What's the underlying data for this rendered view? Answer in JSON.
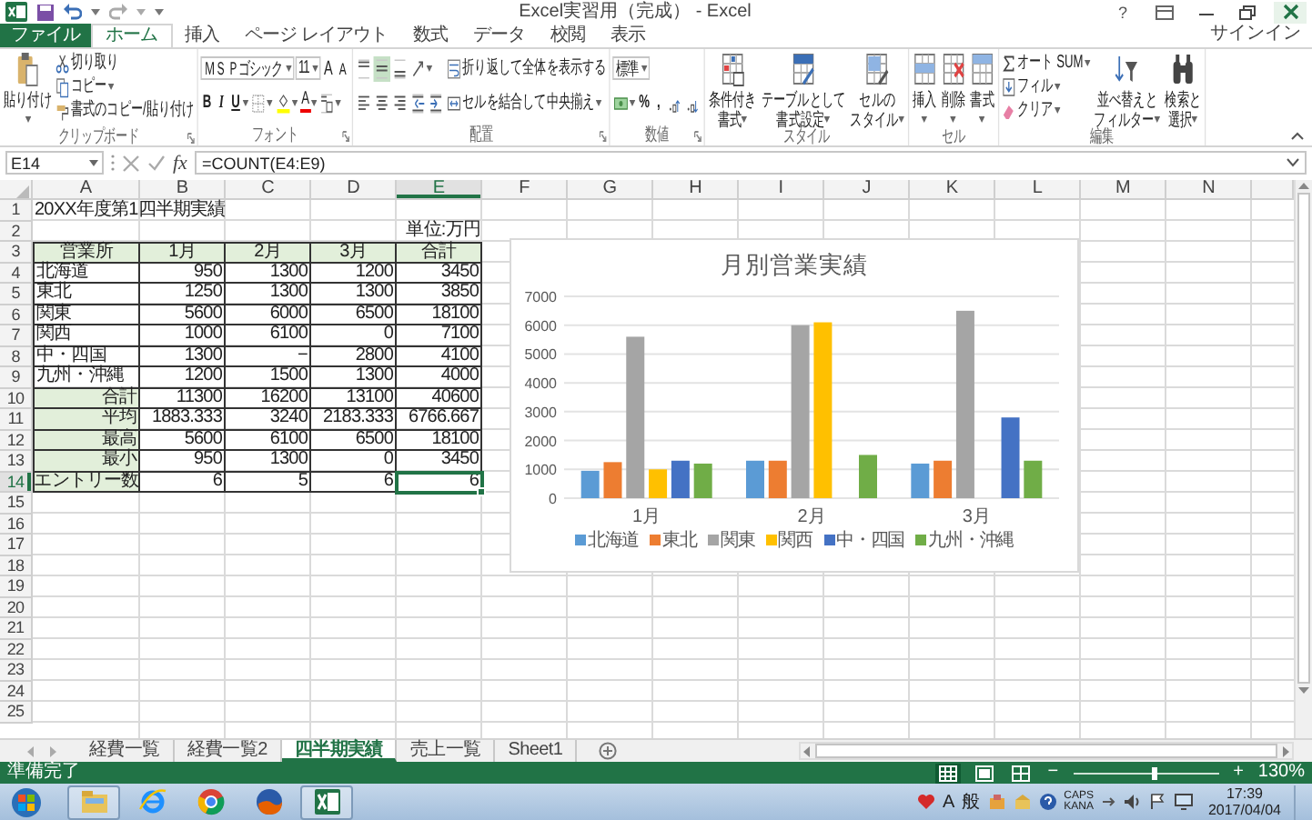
{
  "window": {
    "title": "Excel実習用（完成） - Excel",
    "help": "?",
    "sign_in": "サインイン"
  },
  "ribbon_tabs": [
    {
      "label": "ファイル",
      "kind": "file",
      "selected": false
    },
    {
      "label": "ホーム",
      "kind": "tab",
      "selected": true
    },
    {
      "label": "挿入",
      "kind": "tab",
      "selected": false
    },
    {
      "label": "ページ レイアウト",
      "kind": "tab",
      "selected": false
    },
    {
      "label": "数式",
      "kind": "tab",
      "selected": false
    },
    {
      "label": "データ",
      "kind": "tab",
      "selected": false
    },
    {
      "label": "校閲",
      "kind": "tab",
      "selected": false
    },
    {
      "label": "表示",
      "kind": "tab",
      "selected": false
    }
  ],
  "ribbon_groups": [
    {
      "label": "クリップボード",
      "launcher": true,
      "stacks": [
        [
          [
            {
              "kind": "paste",
              "large": true,
              "lines": [
                "貼り付け"
              ],
              "dropdown": true
            }
          ]
        ],
        [
          [
            {
              "kind": "cut",
              "large": false,
              "label": "切り取り"
            }
          ],
          [
            {
              "kind": "copy",
              "large": false,
              "label": "コピー",
              "dropdown": true
            }
          ],
          [
            {
              "kind": "brush",
              "large": false,
              "label": "書式のコピー/貼り付け"
            }
          ]
        ]
      ]
    },
    {
      "label": "フォント",
      "launcher": true,
      "stacks": [
        [
          [
            {
              "kind": "field",
              "value": "ＭＳ Ｐゴシック",
              "dropdown": true
            },
            {
              "kind": "field",
              "value": "11",
              "dropdown": true
            },
            {
              "kind": "grow",
              "label": "A"
            },
            {
              "kind": "shrink",
              "label": "A"
            }
          ],
          [
            {
              "kind": "glyph",
              "label": "B"
            },
            {
              "kind": "glyph",
              "label": "I"
            },
            {
              "kind": "glyph",
              "label": "U",
              "dropdown": true
            },
            {
              "kind": "border",
              "dropdown": true
            },
            {
              "kind": "bucket",
              "dropdown": true
            },
            {
              "kind": "fontcolor",
              "label": "A",
              "dropdown": true
            },
            {
              "kind": "ruby",
              "dropdown": true
            }
          ]
        ]
      ]
    },
    {
      "label": "配置",
      "launcher": true,
      "stacks": [
        [
          [
            {
              "kind": "aligntop",
              "selected": false
            },
            {
              "kind": "alignmiddle",
              "selected": true
            },
            {
              "kind": "alignbottom",
              "selected": false
            },
            {
              "kind": "orient",
              "dropdown": true
            }
          ],
          [
            {
              "kind": "alignleft",
              "selected": false
            },
            {
              "kind": "aligncenter",
              "selected": false
            },
            {
              "kind": "alignright",
              "selected": false
            },
            {
              "kind": "indentdec"
            },
            {
              "kind": "indentinc"
            }
          ]
        ],
        [
          [
            {
              "kind": "wrap",
              "large": false,
              "label": "折り返して全体を表示する"
            }
          ],
          [
            {
              "kind": "merge",
              "large": false,
              "label": "セルを結合して中央揃え",
              "dropdown": true
            }
          ]
        ]
      ]
    },
    {
      "label": "数値",
      "launcher": true,
      "stacks": [
        [
          [
            {
              "kind": "field",
              "value": "標準",
              "dropdown": true
            }
          ],
          [
            {
              "kind": "currency",
              "dropdown": true
            },
            {
              "kind": "numglyph",
              "label": "%"
            },
            {
              "kind": "numglyph",
              "label": ","
            },
            {
              "kind": "decinc"
            },
            {
              "kind": "decdec"
            }
          ]
        ]
      ]
    },
    {
      "label": "スタイル",
      "launcher": false,
      "stacks": [
        [
          [
            {
              "kind": "cond",
              "large": true,
              "lines": [
                "条件付き",
                "書式"
              ],
              "dropdown": true
            }
          ]
        ],
        [
          [
            {
              "kind": "tableformat",
              "large": true,
              "lines": [
                "テーブルとして",
                "書式設定"
              ],
              "dropdown": true
            }
          ]
        ],
        [
          [
            {
              "kind": "cellstyle",
              "large": true,
              "lines": [
                "セルの",
                "スタイル"
              ],
              "dropdown": true
            }
          ]
        ]
      ]
    },
    {
      "label": "セル",
      "launcher": false,
      "stacks": [
        [
          [
            {
              "kind": "insert",
              "large": true,
              "lines": [
                "挿入"
              ],
              "dropdown": true
            }
          ]
        ],
        [
          [
            {
              "kind": "delete",
              "large": true,
              "lines": [
                "削除"
              ],
              "dropdown": true
            }
          ]
        ],
        [
          [
            {
              "kind": "format",
              "large": true,
              "lines": [
                "書式"
              ],
              "dropdown": true
            }
          ]
        ]
      ]
    },
    {
      "label": "編集",
      "launcher": false,
      "stacks": [
        [
          [
            {
              "kind": "sigma",
              "large": false,
              "label": "オート SUM",
              "dropdown": true
            }
          ],
          [
            {
              "kind": "filldown",
              "large": false,
              "label": "フィル",
              "dropdown": true
            }
          ],
          [
            {
              "kind": "eraser",
              "large": false,
              "label": "クリア",
              "dropdown": true
            }
          ]
        ],
        [
          [
            {
              "kind": "sort",
              "large": true,
              "lines": [
                "並べ替えと",
                "フィルター"
              ],
              "dropdown": true
            }
          ]
        ],
        [
          [
            {
              "kind": "find",
              "large": true,
              "lines": [
                "検索と",
                "選択"
              ],
              "dropdown": true
            }
          ]
        ]
      ]
    }
  ],
  "formula_bar": {
    "name_box": "E14",
    "function_label": "fx",
    "formula": "=COUNT(E4:E9)"
  },
  "sheet": {
    "columns": [
      {
        "label": "A",
        "selected": false
      },
      {
        "label": "B",
        "selected": false
      },
      {
        "label": "C",
        "selected": false
      },
      {
        "label": "D",
        "selected": false
      },
      {
        "label": "E",
        "selected": true
      },
      {
        "label": "F",
        "selected": false
      },
      {
        "label": "G",
        "selected": false
      },
      {
        "label": "H",
        "selected": false
      },
      {
        "label": "I",
        "selected": false
      },
      {
        "label": "J",
        "selected": false
      },
      {
        "label": "K",
        "selected": false
      },
      {
        "label": "L",
        "selected": false
      },
      {
        "label": "M",
        "selected": false
      },
      {
        "label": "N",
        "selected": false
      }
    ],
    "rows": [
      {
        "number": "1",
        "selected": false,
        "kind": "title",
        "text": "20XX年度第1四半期実績"
      },
      {
        "number": "2",
        "selected": false,
        "kind": "unit",
        "text": "単位:万円"
      },
      {
        "number": "3",
        "selected": false,
        "kind": "header",
        "cells": [
          "営業所",
          "1月",
          "2月",
          "3月",
          "合計"
        ]
      },
      {
        "number": "4",
        "selected": false,
        "kind": "data",
        "cells": [
          "北海道",
          "950",
          "1300",
          "1200",
          "3450"
        ]
      },
      {
        "number": "5",
        "selected": false,
        "kind": "data",
        "cells": [
          "東北",
          "1250",
          "1300",
          "1300",
          "3850"
        ]
      },
      {
        "number": "6",
        "selected": false,
        "kind": "data",
        "cells": [
          "関東",
          "5600",
          "6000",
          "6500",
          "18100"
        ]
      },
      {
        "number": "7",
        "selected": false,
        "kind": "data",
        "cells": [
          "関西",
          "1000",
          "6100",
          "0",
          "7100"
        ]
      },
      {
        "number": "8",
        "selected": false,
        "kind": "data",
        "cells": [
          "中・四国",
          "1300",
          "−",
          "2800",
          "4100"
        ]
      },
      {
        "number": "9",
        "selected": false,
        "kind": "data",
        "cells": [
          "九州・沖縄",
          "1200",
          "1500",
          "1300",
          "4000"
        ]
      },
      {
        "number": "10",
        "selected": false,
        "kind": "summary",
        "cells": [
          "合計",
          "11300",
          "16200",
          "13100",
          "40600"
        ]
      },
      {
        "number": "11",
        "selected": false,
        "kind": "summary",
        "cells": [
          "平均",
          "1883.333",
          "3240",
          "2183.333",
          "6766.667"
        ]
      },
      {
        "number": "12",
        "selected": false,
        "kind": "summary",
        "cells": [
          "最高",
          "5600",
          "6100",
          "6500",
          "18100"
        ]
      },
      {
        "number": "13",
        "selected": false,
        "kind": "summary",
        "cells": [
          "最小",
          "950",
          "1300",
          "0",
          "3450"
        ]
      },
      {
        "number": "14",
        "selected": true,
        "kind": "count",
        "cells": [
          "エントリー数",
          "6",
          "5",
          "6",
          "6"
        ]
      },
      {
        "number": "15",
        "selected": false
      },
      {
        "number": "16",
        "selected": false
      },
      {
        "number": "17",
        "selected": false
      },
      {
        "number": "18",
        "selected": false
      },
      {
        "number": "19",
        "selected": false
      },
      {
        "number": "20",
        "selected": false
      },
      {
        "number": "21",
        "selected": false
      },
      {
        "number": "22",
        "selected": false
      },
      {
        "number": "23",
        "selected": false
      },
      {
        "number": "24",
        "selected": false
      },
      {
        "number": "25",
        "selected": false
      }
    ]
  },
  "chart": {
    "chart_data": {
      "type": "bar",
      "title": "月別営業実績",
      "categories": [
        "1月",
        "2月",
        "3月"
      ],
      "grid": true,
      "legend": true,
      "ylim": [
        0,
        7000
      ],
      "yticks": [
        {
          "value": 0,
          "label": "0"
        },
        {
          "value": 1000,
          "label": "1000"
        },
        {
          "value": 2000,
          "label": "2000"
        },
        {
          "value": 3000,
          "label": "3000"
        },
        {
          "value": 4000,
          "label": "4000"
        },
        {
          "value": 5000,
          "label": "5000"
        },
        {
          "value": 6000,
          "label": "6000"
        },
        {
          "value": 7000,
          "label": "7000"
        }
      ],
      "series": [
        {
          "name": "北海道",
          "color": "#5b9bd5",
          "values": [
            950,
            1300,
            1200
          ]
        },
        {
          "name": "東北",
          "color": "#ed7d31",
          "values": [
            1250,
            1300,
            1300
          ]
        },
        {
          "name": "関東",
          "color": "#a5a5a5",
          "values": [
            5600,
            6000,
            6500
          ]
        },
        {
          "name": "関西",
          "color": "#ffc000",
          "values": [
            1000,
            6100,
            0
          ]
        },
        {
          "name": "中・四国",
          "color": "#4472c4",
          "values": [
            1300,
            null,
            2800
          ]
        },
        {
          "name": "九州・沖縄",
          "color": "#70ad47",
          "values": [
            1200,
            1500,
            1300
          ]
        }
      ]
    }
  },
  "sheet_tabs": [
    {
      "label": "経費一覧",
      "selected": false
    },
    {
      "label": "経費一覧2",
      "selected": false
    },
    {
      "label": "四半期実績",
      "selected": true
    },
    {
      "label": "売上一覧",
      "selected": false
    },
    {
      "label": "Sheet1",
      "selected": false
    }
  ],
  "status_bar": {
    "text": "準備完了",
    "views": [
      {
        "kind": "normal",
        "selected": true
      },
      {
        "kind": "layout",
        "selected": false
      },
      {
        "kind": "pagebreak",
        "selected": false
      }
    ],
    "zoom": {
      "minus": "−",
      "plus": "+",
      "level": 0.55,
      "reading": "130%"
    }
  },
  "taskbar": {
    "apps": [
      {
        "kind": "folder",
        "running": true
      },
      {
        "kind": "ie",
        "running": false
      },
      {
        "kind": "chrome",
        "running": false
      },
      {
        "kind": "firefox",
        "running": false
      },
      {
        "kind": "excel",
        "running": true
      }
    ],
    "ime": [
      "A",
      "般"
    ],
    "keys": [
      "CAPS",
      "KANA"
    ],
    "time": "17:39",
    "date": "2017/04/04"
  }
}
